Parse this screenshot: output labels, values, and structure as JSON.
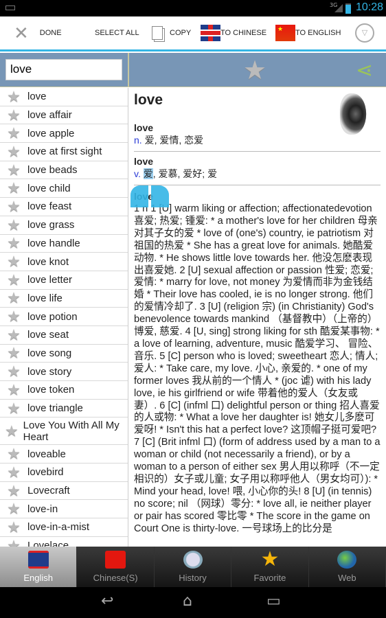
{
  "status": {
    "network": "3G",
    "time": "10:28"
  },
  "actionbar": {
    "done": "DONE",
    "select_all": "SELECT ALL",
    "copy": "COPY",
    "to_chinese": "TO CHINESE",
    "to_english": "TO ENGLISH"
  },
  "search": {
    "value": "love"
  },
  "list": [
    "love",
    "love affair",
    "love apple",
    "love at first sight",
    "love beads",
    "love child",
    "love feast",
    "love grass",
    "love handle",
    "love knot",
    "love letter",
    "love life",
    "love potion",
    "love seat",
    "love song",
    "love story",
    "love token",
    "love triangle",
    "Love You With All My Heart",
    "loveable",
    "lovebird",
    "Lovecraft",
    "love-in",
    "love-in-a-mist",
    "Lovelace"
  ],
  "detail": {
    "headword": "love",
    "entries": [
      {
        "word": "love",
        "pos": "n.",
        "meaning": "爱, 爱情, 恋爱"
      },
      {
        "word": "love",
        "pos": "v.",
        "highlight": "爱",
        "meaning": ", 爱慕, 爱好; 爱"
      }
    ],
    "body_word": "love",
    "body": "1 n 1 [U] warm liking or affection; affectionatedevotion 喜爱; 热爱; 锺爱: * a mother's love for her children 母亲对其子女的爱 * love of (one's) country, ie patriotism 对祖国的热爱 * She has a great love for animals. 她酷爱动物. * He shows little love towards her. 他没怎麽表现出喜爱她. 2 [U] sexual affection or passion 性爱; 恋爱; 爱情: * marry for love, not money 为爱情而非为金钱结婚 * Their love has cooled, ie is no longer strong. 他们的爱情冷却了. 3 [U] (religion 宗) (in Christianity) God's benevolence towards mankind （基督教中）（上帝的）博爱, 慈爱. 4 [U, sing] strong liking for sth 酷爱某事物: * a love of learning, adventure, music 酷爱学习、 冒险、 音乐. 5 [C] person who is loved; sweetheart 恋人; 情人; 爱人: * Take care, my love. 小心, 亲爱的. * one of my former loves 我从前的一个情人 * (joc 谑) with his lady love, ie his girlfriend or wife 带着他的爱人（女友或妻）. 6 [C] (infml 口) delightful person or thing 招人喜爱的人或物: * What a love her daughter is! 她女儿多麽可爱呀! * Isn't this hat a perfect love? 这顶帽子挺可爱吧? 7 [C] (Brit infml 口) (form of address used by a man to a woman or child (not necessarily a friend), or by a woman to a person of either sex 男人用以称呼（不一定相识的）女子或儿童; 女子用以称呼他人（男女均可）): * Mind your head, love! 喂, 小心你的头! 8 [U] (in tennis) no score; nil （网球）零分: * love all, ie neither player or pair has scored 零比零 * The score in the game on Court One is thirty-love. 一号球场上的比分是"
  },
  "tabs": [
    {
      "label": "English",
      "active": true
    },
    {
      "label": "Chinese(S)"
    },
    {
      "label": "History"
    },
    {
      "label": "Favorite"
    },
    {
      "label": "Web"
    }
  ],
  "colors": {
    "accent": "#33b5e5",
    "header": "#7896b6"
  }
}
